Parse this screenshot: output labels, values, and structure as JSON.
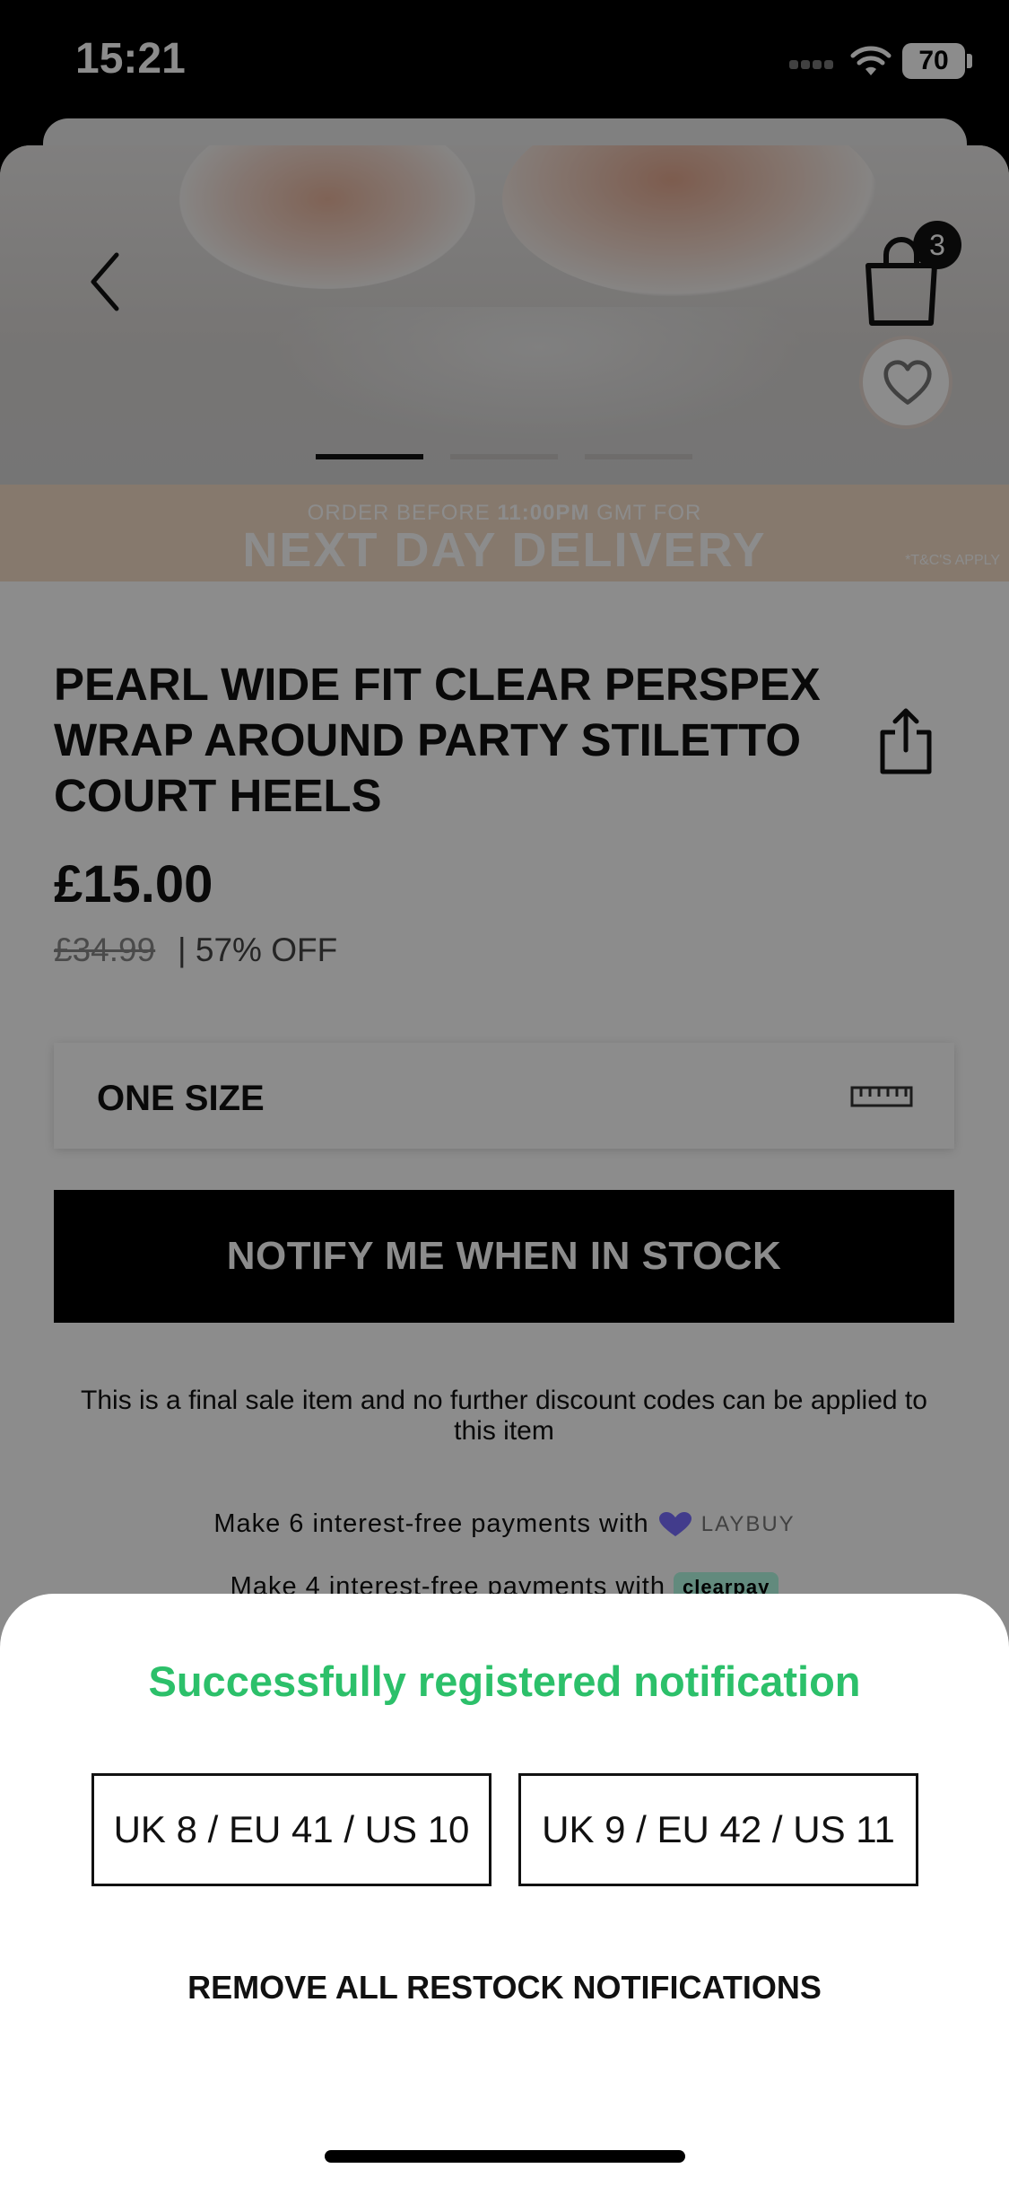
{
  "status_bar": {
    "time": "15:21",
    "battery": "70"
  },
  "header": {
    "cart_count": "3"
  },
  "carousel": {
    "slide_count": 3,
    "active_index": 0
  },
  "promo": {
    "prefix": "ORDER BEFORE ",
    "time": "11:00PM",
    "suffix": " GMT FOR",
    "headline": "NEXT DAY DELIVERY",
    "terms": "*T&C'S APPLY"
  },
  "product": {
    "title": "PEARL WIDE FIT CLEAR PERSPEX WRAP AROUND PARTY STILETTO COURT HEELS",
    "price": "£15.00",
    "old_price": "£34.99",
    "discount": "| 57% OFF"
  },
  "size_selector": {
    "label": "ONE SIZE"
  },
  "actions": {
    "notify_label": "NOTIFY ME WHEN IN STOCK"
  },
  "notes": {
    "final_sale": "This is a final sale item and no further discount codes can be applied to this item"
  },
  "payments": {
    "laybuy_text": "Make 6 interest-free payments with",
    "laybuy_brand": "LAYBUY",
    "clearpay_text": "Make 4 interest-free payments with",
    "clearpay_brand": "clearpay"
  },
  "sheet": {
    "message": "Successfully registered notification",
    "sizes": [
      "UK 8 / EU 41 / US 10",
      "UK 9 / EU 42 / US 11"
    ],
    "remove_all": "REMOVE ALL RESTOCK NOTIFICATIONS"
  },
  "colors": {
    "success": "#2cc06a",
    "promo_bg": "#f4dcc6",
    "button_bg": "#000000",
    "clearpay_badge": "#b2fce4",
    "laybuy_accent": "#786dff"
  }
}
